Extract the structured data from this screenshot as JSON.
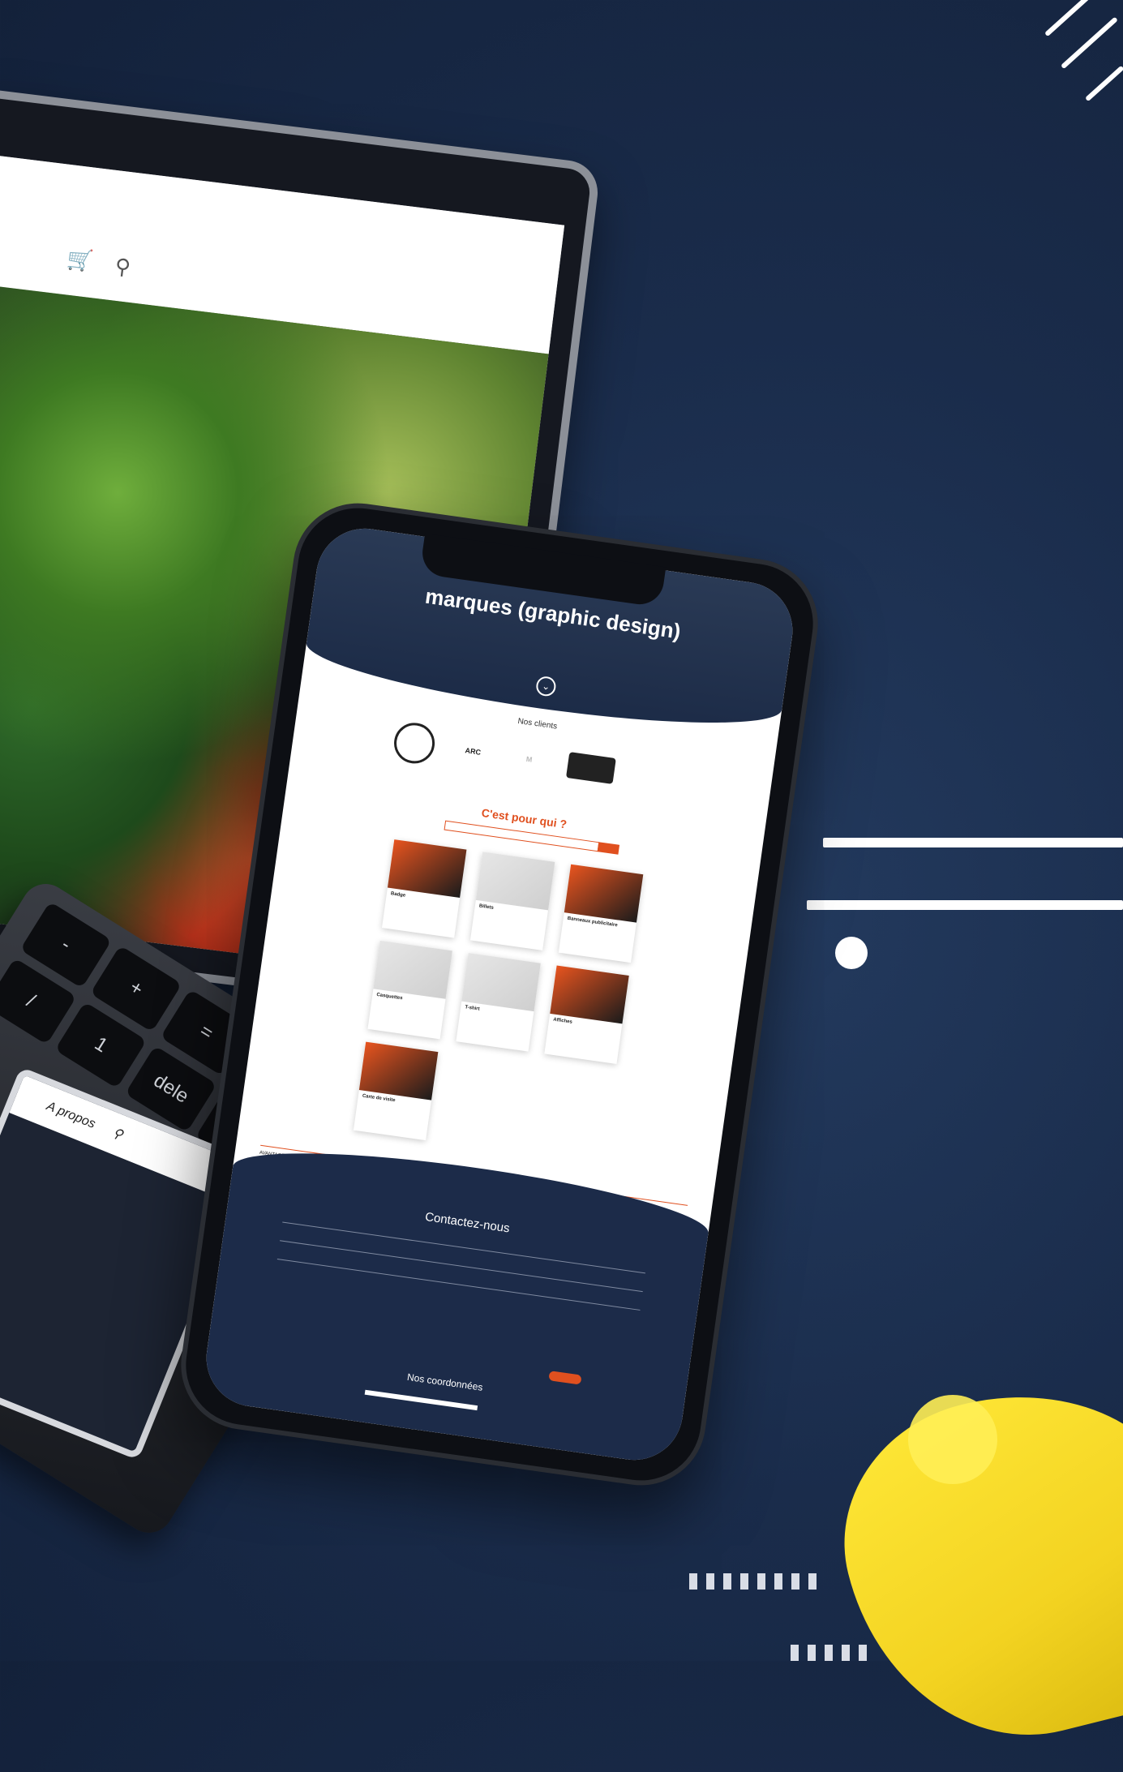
{
  "background": {
    "color": "#1a2c4b",
    "accent_yellow": "#f3d321",
    "accent_orange": "#e0501f"
  },
  "laptop": {
    "nav_icons": [
      "cart-icon",
      "search-icon"
    ],
    "keys": [
      "-",
      "+",
      "=",
      "",
      "/",
      "1",
      "dele",
      ""
    ],
    "tablet_menu": "A propos"
  },
  "phone": {
    "hero_title": "marques (graphic design)",
    "clients_title": "Nos clients",
    "clients": [
      "",
      "ARC",
      "M",
      "",
      ""
    ],
    "who_title": "C'est pour qui ?",
    "products": [
      {
        "name": "Badge"
      },
      {
        "name": "Billets"
      },
      {
        "name": "Banneaux publicitaire"
      },
      {
        "name": "Casquettes"
      },
      {
        "name": "T-shirt"
      },
      {
        "name": "Affiches"
      },
      {
        "name": "Carte de visite"
      }
    ],
    "advantages_title": "AVANTAGES D'ETRE UNE MARQUE",
    "contact_title": "Contactez-nous",
    "coordinates_title": "Nos coordonnées"
  }
}
